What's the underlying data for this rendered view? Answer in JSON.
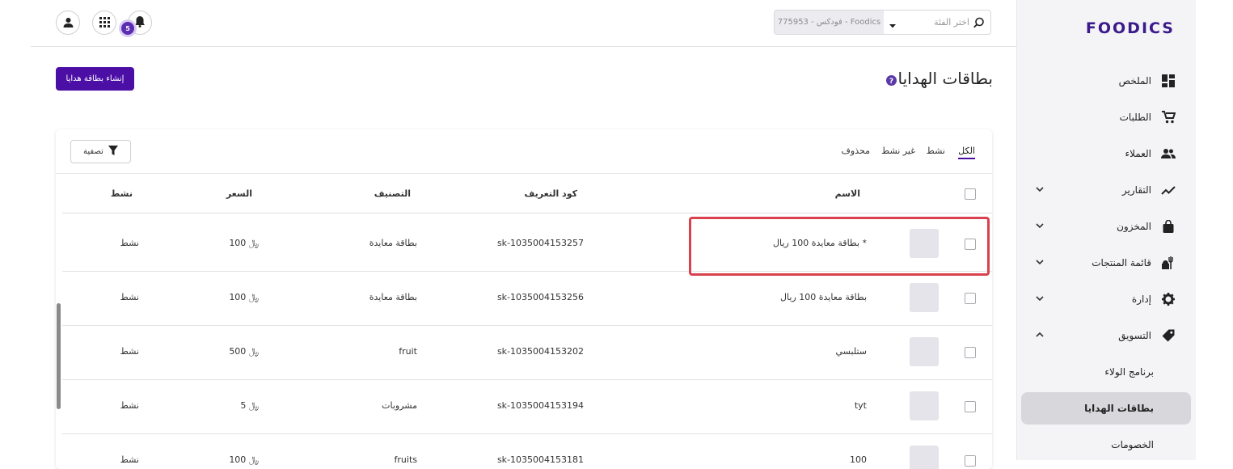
{
  "brand": {
    "logo_text": "FOODICS",
    "accent": "#4b0fa6",
    "badge_color": "#5b2db3"
  },
  "sidebar": {
    "items": [
      {
        "label": "الملخص",
        "icon": "dashboard-icon"
      },
      {
        "label": "الطلبات",
        "icon": "cart-icon"
      },
      {
        "label": "العملاء",
        "icon": "users-icon"
      },
      {
        "label": "التقارير",
        "icon": "chart-line-icon",
        "has_chevron": "down"
      },
      {
        "label": "المخزون",
        "icon": "bag-icon",
        "has_chevron": "down"
      },
      {
        "label": "قائمة المنتجات",
        "icon": "food-icon",
        "has_chevron": "down"
      },
      {
        "label": "إدارة",
        "icon": "gear-icon",
        "has_chevron": "down"
      },
      {
        "label": "التسويق",
        "icon": "tag-icon",
        "has_chevron": "up"
      },
      {
        "label": "برنامج الولاء"
      },
      {
        "label": "بطاقات الهدايا",
        "active": true
      },
      {
        "label": "الخصومات"
      }
    ]
  },
  "topbar": {
    "branch_placeholder": "اختر الفئة",
    "branch_value": "775953 - فودكس - Foodics",
    "notification_count": "5"
  },
  "page": {
    "title": "بطاقات الهدايا",
    "create_button": "إنشاء بطاقة هدايا"
  },
  "tabs": [
    "الكل",
    "نشط",
    "غير نشط",
    "محذوف"
  ],
  "filter_label": "تصفية",
  "table": {
    "columns": [
      "الاسم",
      "كود التعريف",
      "التصنيف",
      "السعر",
      "نشط"
    ],
    "rows": [
      {
        "name": "بطاقة معايدة 100 ريال *",
        "sku": "sk-1035004153257",
        "category": "بطاقة معايدة",
        "price": "100 ﷼",
        "active": "نشط"
      },
      {
        "name": "بطاقة معايدة 100 ريال",
        "sku": "sk-1035004153256",
        "category": "بطاقة معايدة",
        "price": "100 ﷼",
        "active": "نشط"
      },
      {
        "name": "ستلبسي",
        "sku": "sk-1035004153202",
        "category": "fruit",
        "price": "500 ﷼",
        "active": "نشط"
      },
      {
        "name": "tyt",
        "sku": "sk-1035004153194",
        "category": "مشروبات",
        "price": "5 ﷼",
        "active": "نشط"
      },
      {
        "name": "100",
        "sku": "sk-1035004153181",
        "category": "fruits",
        "price": "100 ﷼",
        "active": "نشط"
      }
    ]
  }
}
